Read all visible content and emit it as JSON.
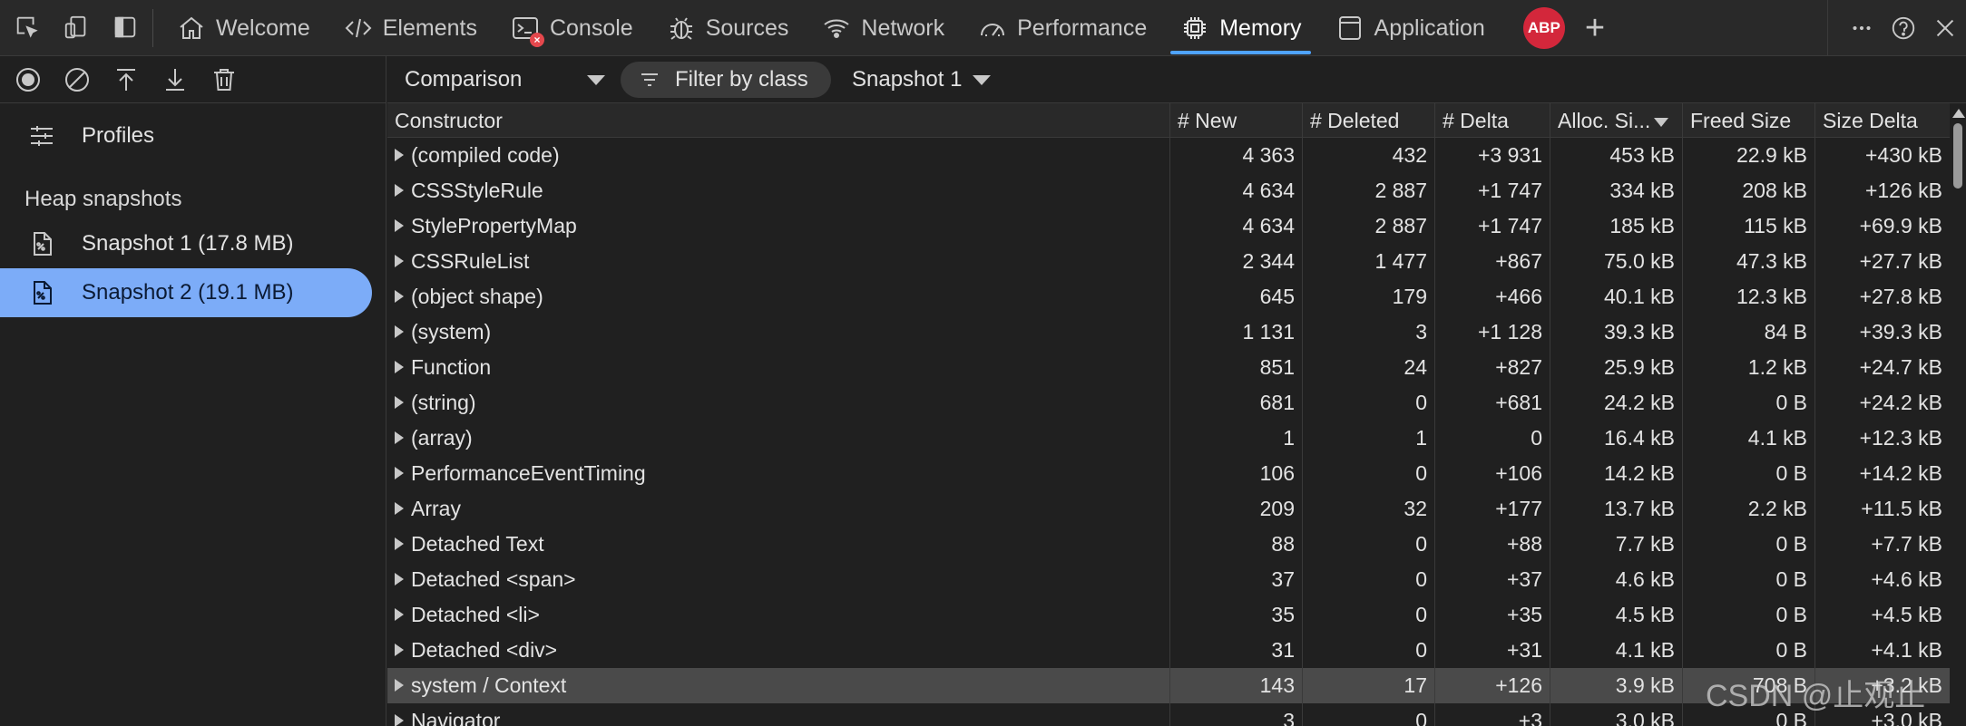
{
  "tabs": [
    {
      "label": "Welcome",
      "icon": "home-icon"
    },
    {
      "label": "Elements",
      "icon": "code-icon"
    },
    {
      "label": "Console",
      "icon": "console-icon"
    },
    {
      "label": "Sources",
      "icon": "bug-icon"
    },
    {
      "label": "Network",
      "icon": "wifi-icon"
    },
    {
      "label": "Performance",
      "icon": "gauge-icon"
    },
    {
      "label": "Memory",
      "icon": "chip-icon",
      "active": true
    },
    {
      "label": "Application",
      "icon": "application-icon"
    }
  ],
  "extension_badge": "ABP",
  "console_error_glyph": "×",
  "sidebar": {
    "profiles_label": "Profiles",
    "heap_snapshots_title": "Heap snapshots",
    "snapshots": [
      {
        "label": "Snapshot 1 (17.8 MB)",
        "selected": false
      },
      {
        "label": "Snapshot 2 (19.1 MB)",
        "selected": true
      }
    ]
  },
  "toolbar": {
    "view_mode": "Comparison",
    "filter_placeholder": "Filter by class",
    "base_snapshot": "Snapshot 1"
  },
  "table": {
    "columns": [
      "Constructor",
      "# New",
      "# Deleted",
      "# Delta",
      "Alloc. Si...",
      "Freed Size",
      "Size Delta"
    ],
    "rows": [
      [
        "(compiled code)",
        "4 363",
        "432",
        "+3 931",
        "453 kB",
        "22.9 kB",
        "+430 kB"
      ],
      [
        "CSSStyleRule",
        "4 634",
        "2 887",
        "+1 747",
        "334 kB",
        "208 kB",
        "+126 kB"
      ],
      [
        "StylePropertyMap",
        "4 634",
        "2 887",
        "+1 747",
        "185 kB",
        "115 kB",
        "+69.9 kB"
      ],
      [
        "CSSRuleList",
        "2 344",
        "1 477",
        "+867",
        "75.0 kB",
        "47.3 kB",
        "+27.7 kB"
      ],
      [
        "(object shape)",
        "645",
        "179",
        "+466",
        "40.1 kB",
        "12.3 kB",
        "+27.8 kB"
      ],
      [
        "(system)",
        "1 131",
        "3",
        "+1 128",
        "39.3 kB",
        "84 B",
        "+39.3 kB"
      ],
      [
        "Function",
        "851",
        "24",
        "+827",
        "25.9 kB",
        "1.2 kB",
        "+24.7 kB"
      ],
      [
        "(string)",
        "681",
        "0",
        "+681",
        "24.2 kB",
        "0 B",
        "+24.2 kB"
      ],
      [
        "(array)",
        "1",
        "1",
        "0",
        "16.4 kB",
        "4.1 kB",
        "+12.3 kB"
      ],
      [
        "PerformanceEventTiming",
        "106",
        "0",
        "+106",
        "14.2 kB",
        "0 B",
        "+14.2 kB"
      ],
      [
        "Array",
        "209",
        "32",
        "+177",
        "13.7 kB",
        "2.2 kB",
        "+11.5 kB"
      ],
      [
        "Detached Text",
        "88",
        "0",
        "+88",
        "7.7 kB",
        "0 B",
        "+7.7 kB"
      ],
      [
        "Detached <span>",
        "37",
        "0",
        "+37",
        "4.6 kB",
        "0 B",
        "+4.6 kB"
      ],
      [
        "Detached <li>",
        "35",
        "0",
        "+35",
        "4.5 kB",
        "0 B",
        "+4.5 kB"
      ],
      [
        "Detached <div>",
        "31",
        "0",
        "+31",
        "4.1 kB",
        "0 B",
        "+4.1 kB"
      ],
      [
        "system / Context",
        "143",
        "17",
        "+126",
        "3.9 kB",
        "708 B",
        "+3.2 kB"
      ],
      [
        "Navigator",
        "3",
        "0",
        "+3",
        "3.0 kB",
        "0 B",
        "+3.0 kB"
      ]
    ],
    "selected_row": 15
  },
  "watermark": "CSDN @止观止",
  "colors": {
    "accent": "#4fa3ff",
    "selection": "#7cacf8",
    "abp": "#d3273b"
  }
}
